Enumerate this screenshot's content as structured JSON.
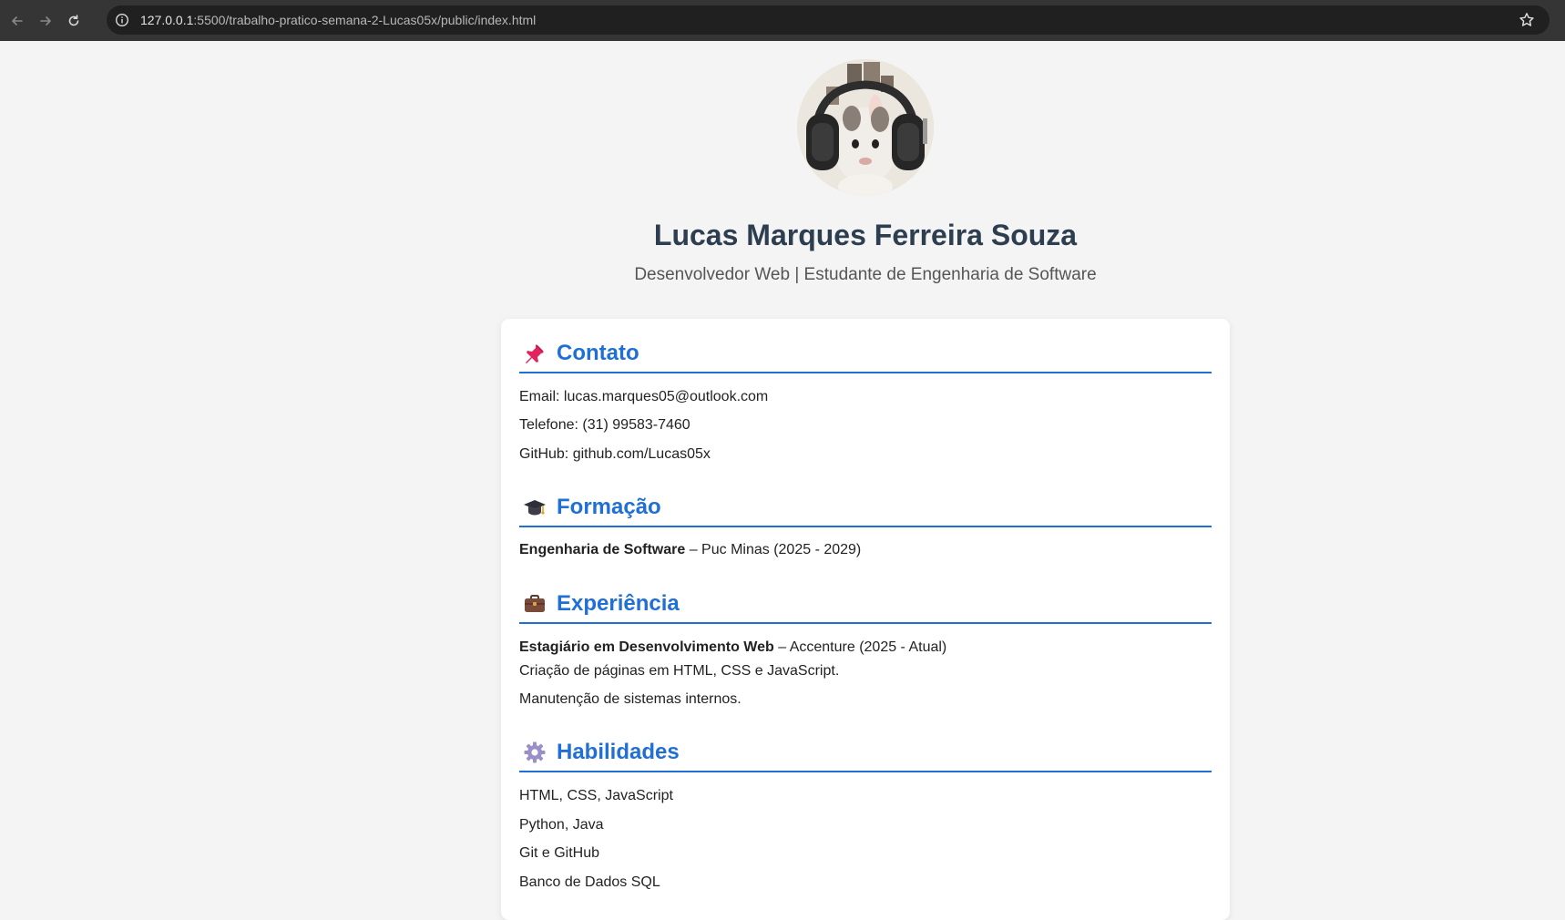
{
  "browser": {
    "url_host": "127.0.0.1",
    "url_rest": ":5500/trabalho-pratico-semana-2-Lucas05x/public/index.html"
  },
  "profile": {
    "name": "Lucas Marques Ferreira Souza",
    "subtitle": "Desenvolvedor Web | Estudante de Engenharia de Software"
  },
  "contato": {
    "title": "Contato",
    "icon": "pushpin-icon",
    "email": "Email: lucas.marques05@outlook.com",
    "telefone": "Telefone: (31) 99583-7460",
    "github": "GitHub: github.com/Lucas05x"
  },
  "formacao": {
    "title": "Formação",
    "icon": "graduation-cap-icon",
    "course": "Engenharia de Software",
    "detail": " – Puc Minas (2025 - 2029)"
  },
  "experiencia": {
    "title": "Experiência",
    "icon": "briefcase-icon",
    "role": "Estagiário em Desenvolvimento Web",
    "detail": " – Accenture (2025 - Atual)",
    "items": [
      "Criação de páginas em HTML, CSS e JavaScript.",
      "Manutenção de sistemas internos."
    ]
  },
  "habilidades": {
    "title": "Habilidades",
    "icon": "gear-icon",
    "items": [
      "HTML, CSS, JavaScript",
      "Python, Java",
      "Git e GitHub",
      "Banco de Dados SQL"
    ]
  },
  "colors": {
    "accent": "#1f6fd6",
    "name": "#2c3e50",
    "background": "#f4f4f4"
  }
}
